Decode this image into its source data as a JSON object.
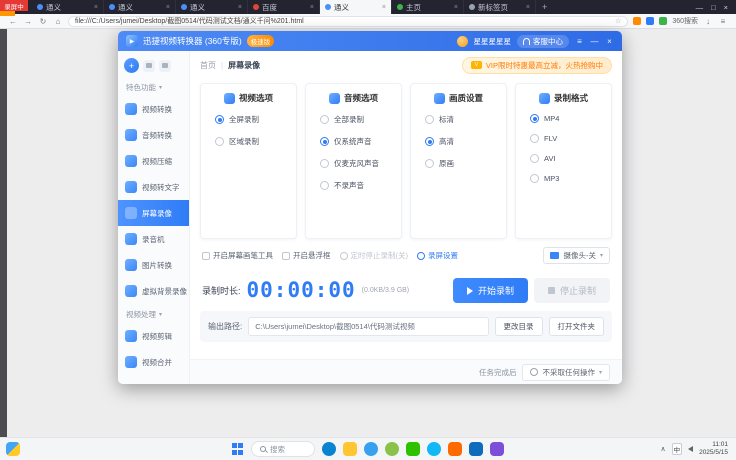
{
  "browser": {
    "recording_badge": "录屏中",
    "tabs": [
      "通义",
      "通义",
      "通义",
      "百度",
      "通义",
      "主页",
      "新标签页"
    ],
    "tab_close": "×",
    "new_tab": "+",
    "controls": {
      "min": "—",
      "max": "□",
      "close": "×"
    },
    "nav": {
      "back": "←",
      "forward": "→",
      "refresh": "↻",
      "home": "⌂",
      "star": "☆",
      "download": "↓",
      "menu": "≡"
    },
    "url": "file:///C:/Users/jumei/Desktop/截图0514/代码测试文档/通义千问%201.html",
    "search_engine": "360搜索"
  },
  "app": {
    "title": "迅捷视频转换器 (360专版)",
    "edition": "极速版",
    "user": "星星星星星",
    "support": "客服中心",
    "menu_icon": "≡",
    "min_icon": "—",
    "close_icon": "×",
    "vip_banner": "VIP限时特惠最高立减，火热抢购中",
    "breadcrumb": {
      "home": "首页",
      "divider": "|",
      "current": "屏幕录像"
    },
    "toolbar": {
      "add": "+"
    },
    "sidebar": {
      "section1": {
        "label": "特色功能",
        "caret": "▾",
        "items": [
          "视频转换",
          "音频转换",
          "视频压缩",
          "视频转文字",
          "屏幕录像",
          "录音机",
          "图片转换",
          "虚拟背景录像"
        ]
      },
      "section2": {
        "label": "视频处理",
        "caret": "▾",
        "items": [
          "视频剪辑",
          "视频合并"
        ]
      }
    },
    "panels": [
      {
        "title": "视频选项",
        "options": [
          {
            "label": "全屏录制",
            "selected": true
          },
          {
            "label": "区域录制",
            "selected": false
          }
        ]
      },
      {
        "title": "音频选项",
        "options": [
          {
            "label": "全部录制",
            "selected": false
          },
          {
            "label": "仅系统声音",
            "selected": true
          },
          {
            "label": "仅麦克风声音",
            "selected": false
          },
          {
            "label": "不录声音",
            "selected": false
          }
        ]
      },
      {
        "title": "画质设置",
        "options": [
          {
            "label": "标清",
            "selected": false
          },
          {
            "label": "高清",
            "selected": true
          },
          {
            "label": "原画",
            "selected": false
          }
        ]
      },
      {
        "title": "录制格式",
        "options": [
          {
            "label": "MP4",
            "selected": true
          },
          {
            "label": "FLV",
            "selected": false
          },
          {
            "label": "AVI",
            "selected": false
          },
          {
            "label": "MP3",
            "selected": false
          }
        ]
      }
    ],
    "options_row": {
      "paint_tool": "开启屏幕画笔工具",
      "float_box": "开启悬浮框",
      "timer": "定时停止录制(关)",
      "settings": "录屏设置",
      "camera": "摄像头-关",
      "caret": "▾"
    },
    "record": {
      "duration_label": "录制时长:",
      "duration": "00:00:00",
      "size": "(0.0KB/3.9 GB)",
      "start": "开始录制",
      "stop": "停止录制"
    },
    "output": {
      "label": "输出路径:",
      "path": "C:\\Users\\jumei\\Desktop\\截图0514\\代码测试视频",
      "change": "更改目录",
      "open": "打开文件夹"
    },
    "footer": {
      "label": "任务完成后",
      "action": "不采取任何操作",
      "caret": "▾"
    }
  },
  "taskbar": {
    "search": "搜索",
    "ime": "中",
    "tray_chevron": "∧",
    "time": "11:01",
    "date": "2025/5/15"
  }
}
